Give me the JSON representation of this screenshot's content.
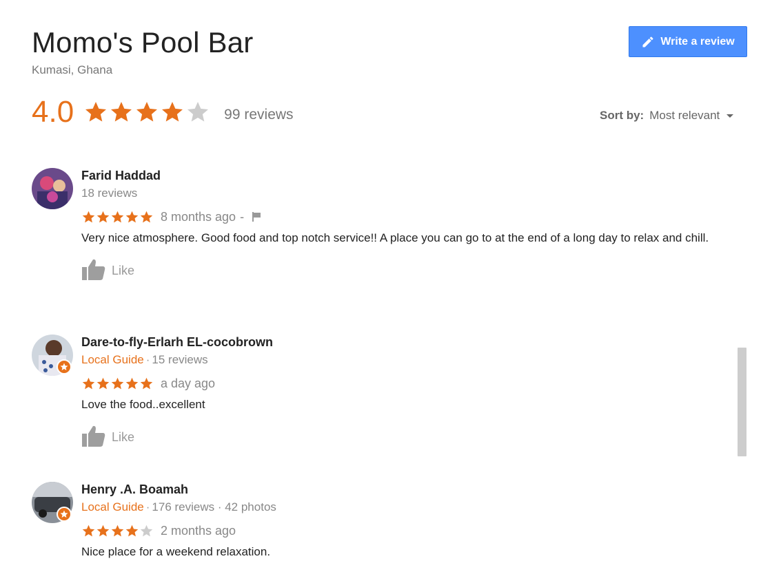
{
  "place": {
    "name": "Momo's Pool Bar",
    "location": "Kumasi, Ghana"
  },
  "write_review": {
    "label": "Write a review",
    "icon": "pencil-icon"
  },
  "rating": {
    "value": "4.0",
    "stars": 4,
    "max_stars": 5,
    "review_count": "99 reviews"
  },
  "sort": {
    "label": "Sort by:",
    "value": "Most relevant"
  },
  "colors": {
    "star": "#e7711b",
    "star_empty": "#cccccc",
    "button": "#4d90fe",
    "guide": "#e7711b"
  },
  "reviews": [
    {
      "author": "Farid Haddad",
      "local_guide": "",
      "stats": "18 reviews",
      "stars": 5,
      "time": "8 months ago",
      "separator": "-",
      "has_flag": true,
      "text": "Very nice atmosphere. Good food and top notch service!! A place you can go to at the end of a long day to relax and chill.",
      "like": "Like"
    },
    {
      "author": "Dare-to-fly-Erlarh EL-cocobrown",
      "local_guide": "Local Guide",
      "stats": "15 reviews",
      "stars": 5,
      "time": "a day ago",
      "separator": "",
      "has_flag": false,
      "text": "Love the food..excellent",
      "like": "Like"
    },
    {
      "author": "Henry .A. Boamah",
      "local_guide": "Local Guide",
      "stats": "176 reviews · 42 photos",
      "stars": 4,
      "time": "2 months ago",
      "separator": "",
      "has_flag": false,
      "text": "Nice place for a weekend relaxation.",
      "like": ""
    }
  ]
}
